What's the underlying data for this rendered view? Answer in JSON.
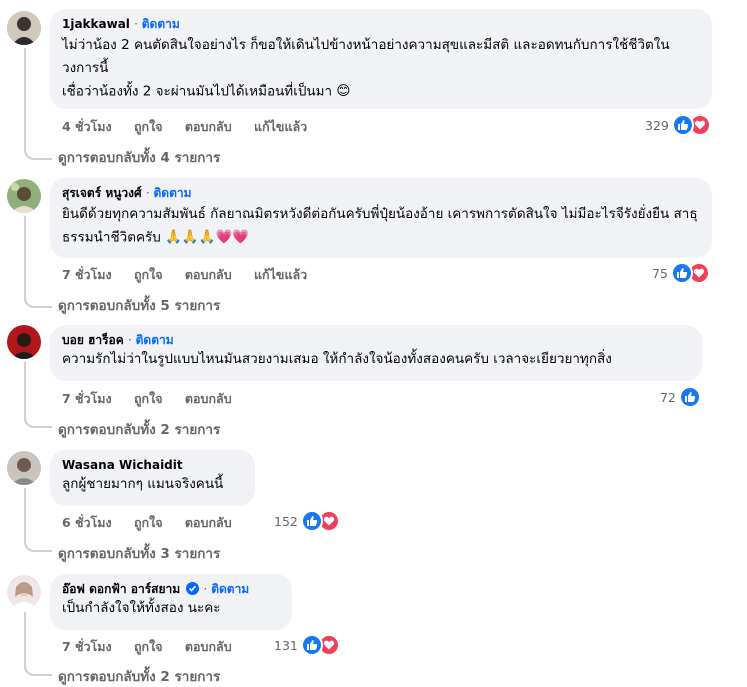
{
  "comments": [
    {
      "author": "1jakkawal",
      "follow": "ติดตาม",
      "text": "ไม่ว่าน้อง 2 คนตัดสินใจอย่างไร ก็ขอให้เดินไปข้างหน้าอย่างความสุขและมีสติ และอดทนกับการใช้ชีวิตในวงการนี้\nเชื่อว่าน้องทั้ง 2 จะผ่านมันไปได้เหมือนที่เป็นมา",
      "emoji": "😊",
      "time": "4 ชั่วโมง",
      "like": "ถูกใจ",
      "reply": "ตอบกลับ",
      "edited": "แก้ไขแล้ว",
      "reaction_count": "329",
      "reactions": [
        "like-icon",
        "love-icon"
      ],
      "view_replies": "ดูการตอบกลับทั้ง 4 รายการ"
    },
    {
      "author": "สุรเจตร์ หนูวงศ์",
      "follow": "ติดตาม",
      "text": "ยินดีด้วยทุกความสัมพันธ์ กัลยาณมิตรหวังดีต่อกันครับพี่ปุ๋ยน้องอ้าย เคารพการตัดสินใจ ไม่มีอะไรจีรังยั่งยืน สาธุธรรมนำชีวิตครับ",
      "emoji": "🙏🙏🙏💗💗",
      "time": "7 ชั่วโมง",
      "like": "ถูกใจ",
      "reply": "ตอบกลับ",
      "edited": "แก้ไขแล้ว",
      "reaction_count": "75",
      "reactions": [
        "like-icon",
        "love-icon"
      ],
      "view_replies": "ดูการตอบกลับทั้ง 5 รายการ"
    },
    {
      "author": "บอย ฮาร็อค",
      "follow": "ติดตาม",
      "text": "ความรักไม่ว่าในรูปแบบไหนมันสวยงามเสมอ ให้กำลังใจน้องทั้งสองคนครับ เวลาจะเยียวยาทุกสิ่ง",
      "time": "7 ชั่วโมง",
      "like": "ถูกใจ",
      "reply": "ตอบกลับ",
      "reaction_count": "72",
      "reactions": [
        "like-icon"
      ],
      "view_replies": "ดูการตอบกลับทั้ง 2 รายการ"
    },
    {
      "author": "Wasana Wichaidit",
      "text": "ลูกผู้ชายมากๆ แมนจริงคนนี้",
      "time": "6 ชั่วโมง",
      "like": "ถูกใจ",
      "reply": "ตอบกลับ",
      "reaction_count": "152",
      "reactions": [
        "like-icon",
        "love-icon"
      ],
      "view_replies": "ดูการตอบกลับทั้ง 3 รายการ"
    },
    {
      "author": "อ๊อฟ ดอกฟ้า อาร์สยาม",
      "verified_icon": "verified-badge-icon",
      "follow": "ติดตาม",
      "text": "เป็นกำลังใจให้ทั้งสอง นะคะ",
      "time": "7 ชั่วโมง",
      "like": "ถูกใจ",
      "reply": "ตอบกลับ",
      "reaction_count": "131",
      "reactions": [
        "like-icon",
        "love-icon"
      ],
      "view_replies": "ดูการตอบกลับทั้ง 2 รายการ"
    }
  ],
  "colors": {
    "follow": "#0866ff",
    "like": "#1877f2",
    "love": "#f33e58",
    "muted": "#65676b",
    "bubble": "#f0f2f5"
  }
}
